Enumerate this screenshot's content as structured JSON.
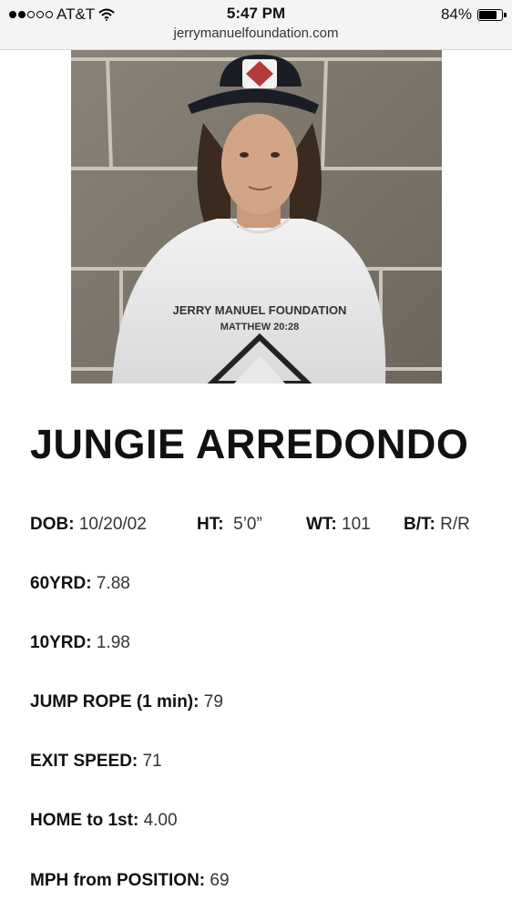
{
  "status_bar": {
    "carrier": "AT&T",
    "time": "5:47 PM",
    "url": "jerrymanuelfoundation.com",
    "battery_percent": "84%",
    "battery_level": 0.84
  },
  "player": {
    "name": "JUNGIE ARREDONDO",
    "photo": {
      "shirt_text": "JERRY MANUEL FOUNDATION",
      "shirt_subtext": "MATTHEW 20:28"
    }
  },
  "stats_row": [
    {
      "label": "DOB:",
      "value": "10/20/02"
    },
    {
      "label": "HT:",
      "value": "5’0”"
    },
    {
      "label": "WT:",
      "value": "101"
    },
    {
      "label": "B/T:",
      "value": "R/R"
    }
  ],
  "stats": [
    {
      "label": "60YRD:",
      "value": "7.88"
    },
    {
      "label": "10YRD:",
      "value": "1.98"
    },
    {
      "label": "JUMP ROPE (1 min):",
      "value": "79"
    },
    {
      "label": "EXIT SPEED:",
      "value": "71"
    },
    {
      "label": "HOME to 1st:",
      "value": "4.00"
    },
    {
      "label": "MPH from POSITION:",
      "value": "69"
    }
  ]
}
